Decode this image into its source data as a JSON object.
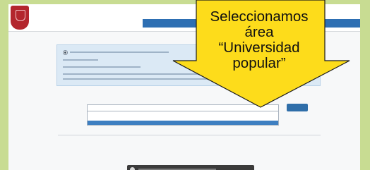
{
  "callout": {
    "line1": "Seleccionamos",
    "line2": "área",
    "line3": "“Universidad",
    "line4": "popular”"
  },
  "colors": {
    "frame": "#c8dc92",
    "callout_fill": "#fddc1b",
    "header_blue": "#2d6fb3",
    "selected_option": "#3e7fc1",
    "logo_red": "#b3262d"
  },
  "icons": {
    "logo": "crest-icon",
    "radio": "radio-icon",
    "play": "play-icon"
  }
}
